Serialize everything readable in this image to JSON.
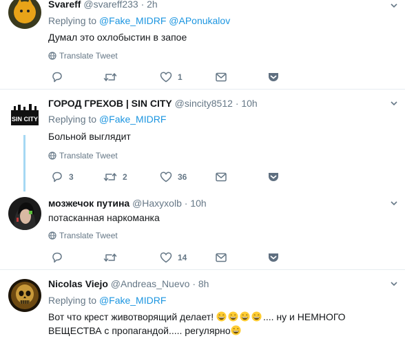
{
  "tweets": [
    {
      "name": "Svareff",
      "handle": "@svareff233",
      "time": "· 2h",
      "replying_prefix": "Replying to",
      "replying_to": "@Fake_MIDRF @APonukalov",
      "text": "Думал это охлобыстин в запое",
      "translate": "Translate Tweet",
      "replies": "",
      "retweets": "",
      "likes": "1"
    },
    {
      "name": "ГОРОД ГРЕХОВ | SIN CITY",
      "handle": "@sincity8512",
      "time": "· 10h",
      "replying_prefix": "Replying to",
      "replying_to": "@Fake_MIDRF",
      "text": "Больной выглядит",
      "translate": "Translate Tweet",
      "replies": "3",
      "retweets": "2",
      "likes": "36",
      "avatar_text": "SIN CITY"
    },
    {
      "name": "мозжечок путина",
      "handle": "@Haxyxolb",
      "time": "· 10h",
      "text": "потасканная наркоманка",
      "translate": "Translate Tweet",
      "replies": "",
      "retweets": "",
      "likes": "14"
    },
    {
      "name": "Nicolas Viejo",
      "handle": "@Andreas_Nuevo",
      "time": "· 8h",
      "replying_prefix": "Replying to",
      "replying_to": "@Fake_MIDRF",
      "text_line1": "Вот что крест животворящий делает!",
      "text_line1_after": ".... ну и НЕМНОГО",
      "text_line2": "ВЕЩЕСТВА с пропагандой..... регулярно"
    }
  ],
  "colors": {
    "link": "#1b95e0",
    "muted": "#657786",
    "thread": "#a5d8f3",
    "separator": "#e6ecf0"
  },
  "icons": [
    "reply-icon",
    "retweet-icon",
    "like-icon",
    "message-icon",
    "pocket-icon",
    "globe-icon",
    "chevron-down-icon",
    "grinning-emoji-icon"
  ]
}
